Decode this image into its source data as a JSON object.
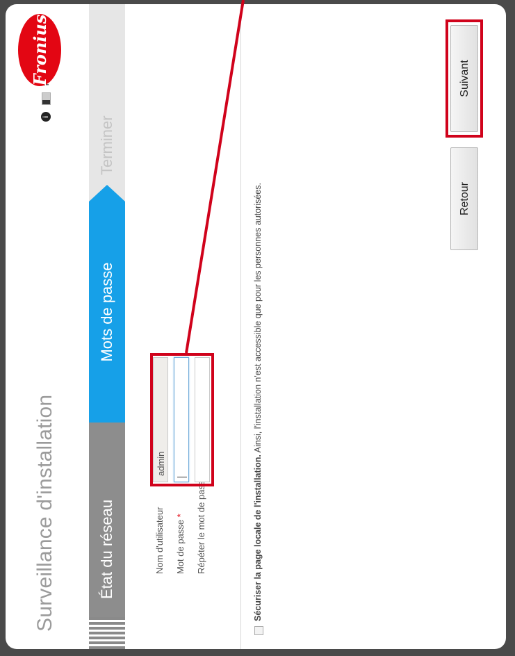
{
  "header": {
    "app_title": "Surveillance d'installation",
    "info_label": "i",
    "language": "fr",
    "logo_text": "Fronius"
  },
  "steps": [
    {
      "label": "État du réseau",
      "state": "done"
    },
    {
      "label": "Mots de passe",
      "state": "active"
    },
    {
      "label": "Terminer",
      "state": "pending"
    }
  ],
  "form": {
    "username_label": "Nom d'utilisateur",
    "username_value": "admin",
    "password_label": "Mot de passe",
    "repeat_password_label": "Répéter le mot de passe",
    "required_mark": "*"
  },
  "secure": {
    "bold_text": "Sécuriser la page locale de l'installation.",
    "text": " Ainsi, l'installation n'est accessible que pour les personnes autorisées.",
    "checked": false
  },
  "buttons": {
    "back_label": "Retour",
    "next_label": "Suivant"
  },
  "colors": {
    "accent": "#16a0e8",
    "highlight": "#d0021b",
    "brand": "#e30613"
  }
}
